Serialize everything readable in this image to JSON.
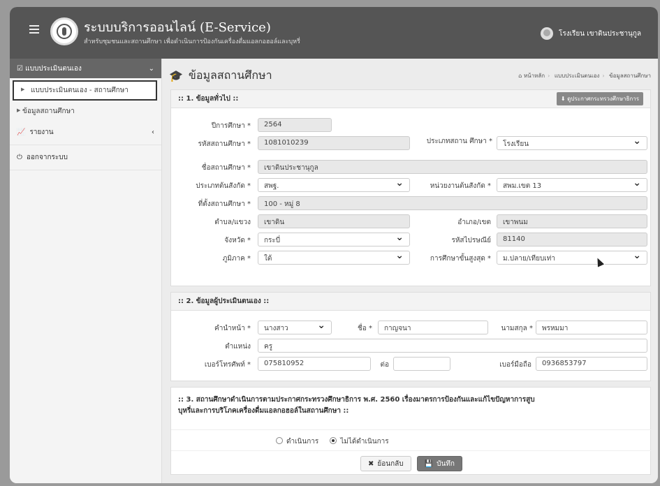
{
  "header": {
    "app_title": "ระบบบริการออนไลน์ (E-Service)",
    "app_subtitle": "สำหรับชุมชนและสถานศึกษา เพื่อดำเนินการป้องกันเครื่องดื่มแอลกอฮอล์และบุหรี่",
    "user_name": "โรงเรียน เขาดินประชานุกูล"
  },
  "sidebar": {
    "section_label": "แบบประเมินตนเอง",
    "items": [
      {
        "label": "แบบประเมินตนเอง - สถานศึกษา"
      },
      {
        "label": "ข้อมูลสถานศึกษา"
      }
    ],
    "report_label": "รายงาน",
    "logout_label": "ออกจากระบบ"
  },
  "page": {
    "title": "ข้อมูลสถานศึกษา",
    "breadcrumb": [
      "หน้าหลัก",
      "แบบประเมินตนเอง",
      "ข้อมูลสถานศึกษา"
    ]
  },
  "section1": {
    "title": ":: 1. ข้อมูลทั่วไป ::",
    "download_label": "ดูประกาศกระทรวงศึกษาธิการ",
    "fields": {
      "academic_year": {
        "label": "ปีการศึกษา *",
        "value": "2564"
      },
      "school_code": {
        "label": "รหัสสถานศึกษา *",
        "value": "1081010239"
      },
      "school_type": {
        "label": "ประเภทสถาน ศึกษา *",
        "value": "โรงเรียน"
      },
      "school_name": {
        "label": "ชื่อสถานศึกษา *",
        "value": "เขาดินประชานุกูล"
      },
      "affiliation_type": {
        "label": "ประเภทต้นสังกัด *",
        "value": "สพฐ."
      },
      "affiliation_unit": {
        "label": "หน่วยงานต้นสังกัด *",
        "value": "สพม.เขต 13"
      },
      "address": {
        "label": "ที่ตั้งสถานศึกษา *",
        "value": "100 - หมู่ 8"
      },
      "subdistrict": {
        "label": "ตำบล/แขวง",
        "value": "เขาดิน"
      },
      "district": {
        "label": "อำเภอ/เขต",
        "value": "เขาพนม"
      },
      "province": {
        "label": "จังหวัด *",
        "value": "กระบี่"
      },
      "postcode": {
        "label": "รหัสไปรษณีย์",
        "value": "81140"
      },
      "region": {
        "label": "ภูมิภาค *",
        "value": "ใต้"
      },
      "highest_level": {
        "label": "การศึกษาขั้นสูงสุด *",
        "value": "ม.ปลาย/เทียบเท่า"
      }
    }
  },
  "section2": {
    "title": ":: 2. ข้อมูลผู้ประเมินตนเอง ::",
    "fields": {
      "prefix": {
        "label": "คำนำหน้า *",
        "value": "นางสาว"
      },
      "first_name": {
        "label": "ชื่อ *",
        "value": "กาญจนา"
      },
      "last_name": {
        "label": "นามสกุล *",
        "value": "พรหมมา"
      },
      "position": {
        "label": "ตำแหน่ง",
        "value": "ครู"
      },
      "phone": {
        "label": "เบอร์โทรศัพท์ *",
        "value": "075810952"
      },
      "ext": {
        "label": "ต่อ",
        "value": ""
      },
      "mobile": {
        "label": "เบอร์มือถือ",
        "value": "0936853797"
      }
    }
  },
  "section3": {
    "title_line1": ":: 3. สถานศึกษาดำเนินการตามประกาศกระทรวงศึกษาธิการ พ.ศ. 2560 เรื่องมาตรการป้องกันและแก้ไขปัญหาการสูบ",
    "title_line2": "บุหรี่และการบริโภคเครื่องดื่มแอลกอฮอล์ในสถานศึกษา ::",
    "options": [
      "ดำเนินการ",
      "ไม่ได้ดำเนินการ"
    ],
    "selected": "ไม่ได้ดำเนินการ"
  },
  "actions": {
    "back_label": "ย้อนกลับ",
    "save_label": "บันทึก"
  }
}
